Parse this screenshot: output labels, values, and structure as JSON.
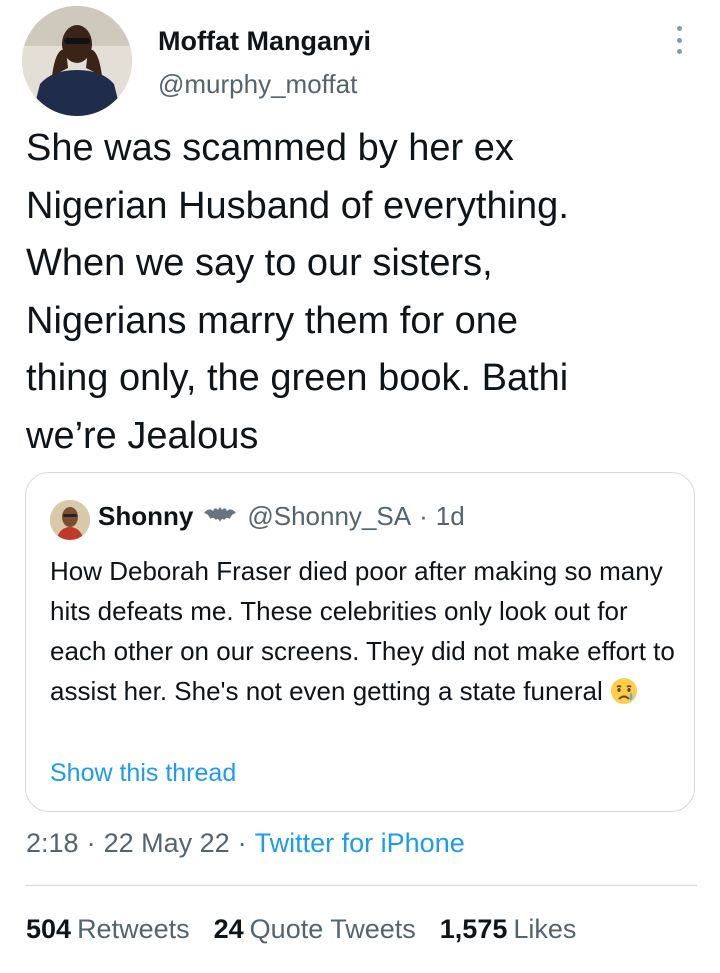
{
  "tweet": {
    "display_name": "Moffat Manganyi",
    "handle": "@murphy_moffat",
    "text": "She was scammed by her ex\nNigerian Husband of everything.\nWhen we say to our sisters,\nNigerians marry them for one\nthing only, the green book. Bathi\nwe’re Jealous",
    "more_icon": "more-vertical-icon"
  },
  "quoted": {
    "display_name": "Shonny",
    "badge_icon": "bat-emoji-icon",
    "handle": "@Shonny_SA",
    "dot": "·",
    "time": "1d",
    "text": "How Deborah Fraser died poor after making so many hits defeats me.  These celebrities only look out for each other on our screens. They did not make effort to assist her. She's not even getting a state funeral",
    "emoji_icon": "crying-face-emoji-icon",
    "show_thread": "Show this thread"
  },
  "meta": {
    "time": "2:18",
    "sep": "·",
    "date": "22 May 22",
    "source": "Twitter for iPhone"
  },
  "stats": {
    "retweets_count": "504",
    "retweets_label": "Retweets",
    "quotes_count": "24",
    "quotes_label": "Quote Tweets",
    "likes_count": "1,575",
    "likes_label": "Likes"
  },
  "colors": {
    "link": "#1d9bf0",
    "secondary_text": "#536471",
    "border": "#cfd9de"
  }
}
